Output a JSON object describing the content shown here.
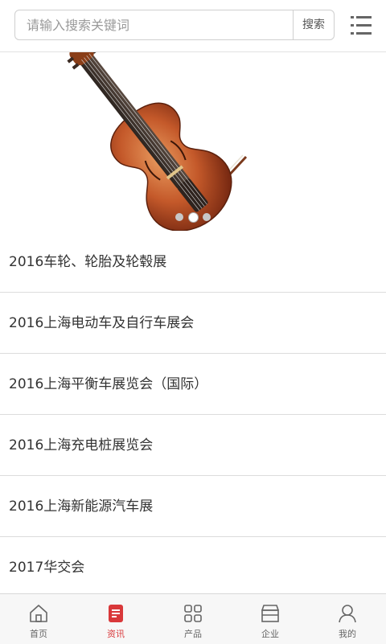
{
  "search": {
    "placeholder": "请输入搜索关键词",
    "button_label": "搜索"
  },
  "header": {
    "menu_icon": "list-menu-icon"
  },
  "banner": {
    "image": "violin-image",
    "slide_count": 3,
    "active_slide": 2
  },
  "news": [
    {
      "title": "2016车轮、轮胎及轮毂展"
    },
    {
      "title": "2016上海电动车及自行车展会"
    },
    {
      "title": "2016上海平衡车展览会（国际）"
    },
    {
      "title": "2016上海充电桩展览会"
    },
    {
      "title": "2016上海新能源汽车展"
    },
    {
      "title": "2017华交会"
    }
  ],
  "bottom_nav": [
    {
      "label": "首页",
      "icon": "home-icon"
    },
    {
      "label": "资讯",
      "icon": "news-icon",
      "active": true
    },
    {
      "label": "产品",
      "icon": "grid-icon"
    },
    {
      "label": "企业",
      "icon": "store-icon"
    },
    {
      "label": "我的",
      "icon": "user-icon"
    }
  ],
  "colors": {
    "accent": "#d9383a",
    "text": "#333333",
    "divider": "#dcdcdc"
  }
}
